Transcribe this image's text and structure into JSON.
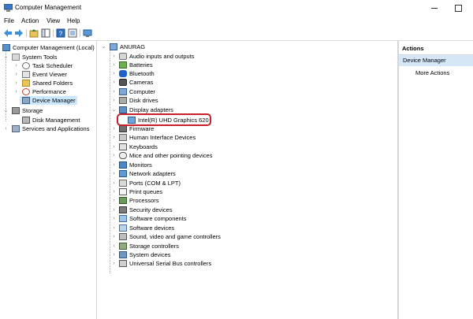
{
  "window": {
    "title": "Computer Management"
  },
  "menu": [
    "File",
    "Action",
    "View",
    "Help"
  ],
  "toolbar": {
    "icons": [
      "back-arrow-icon",
      "forward-arrow-icon",
      "up-folder-icon",
      "console-tree-icon",
      "help-icon",
      "properties-icon",
      "monitor-icon"
    ]
  },
  "left_tree": {
    "root": "Computer Management (Local)",
    "system_tools": "System Tools",
    "task_scheduler": "Task Scheduler",
    "event_viewer": "Event Viewer",
    "shared_folders": "Shared Folders",
    "performance": "Performance",
    "device_manager": "Device Manager",
    "storage": "Storage",
    "disk_management": "Disk Management",
    "services": "Services and Applications"
  },
  "device_tree": {
    "computer_name": "ANURAG",
    "categories": [
      "Audio inputs and outputs",
      "Batteries",
      "Bluetooth",
      "Cameras",
      "Computer",
      "Disk drives",
      "Display adapters",
      "Intel(R) UHD Graphics 620",
      "Firmware",
      "Human Interface Devices",
      "Keyboards",
      "Mice and other pointing devices",
      "Monitors",
      "Network adapters",
      "Ports (COM & LPT)",
      "Print queues",
      "Processors",
      "Security devices",
      "Software components",
      "Software devices",
      "Sound, video and game controllers",
      "Storage controllers",
      "System devices",
      "Universal Serial Bus controllers"
    ]
  },
  "actions": {
    "title": "Actions",
    "section": "Device Manager",
    "more": "More Actions"
  },
  "colors": {
    "selection": "#cce8ff",
    "highlight_border": "#c8202a",
    "actions_section": "#d5e6f7"
  }
}
